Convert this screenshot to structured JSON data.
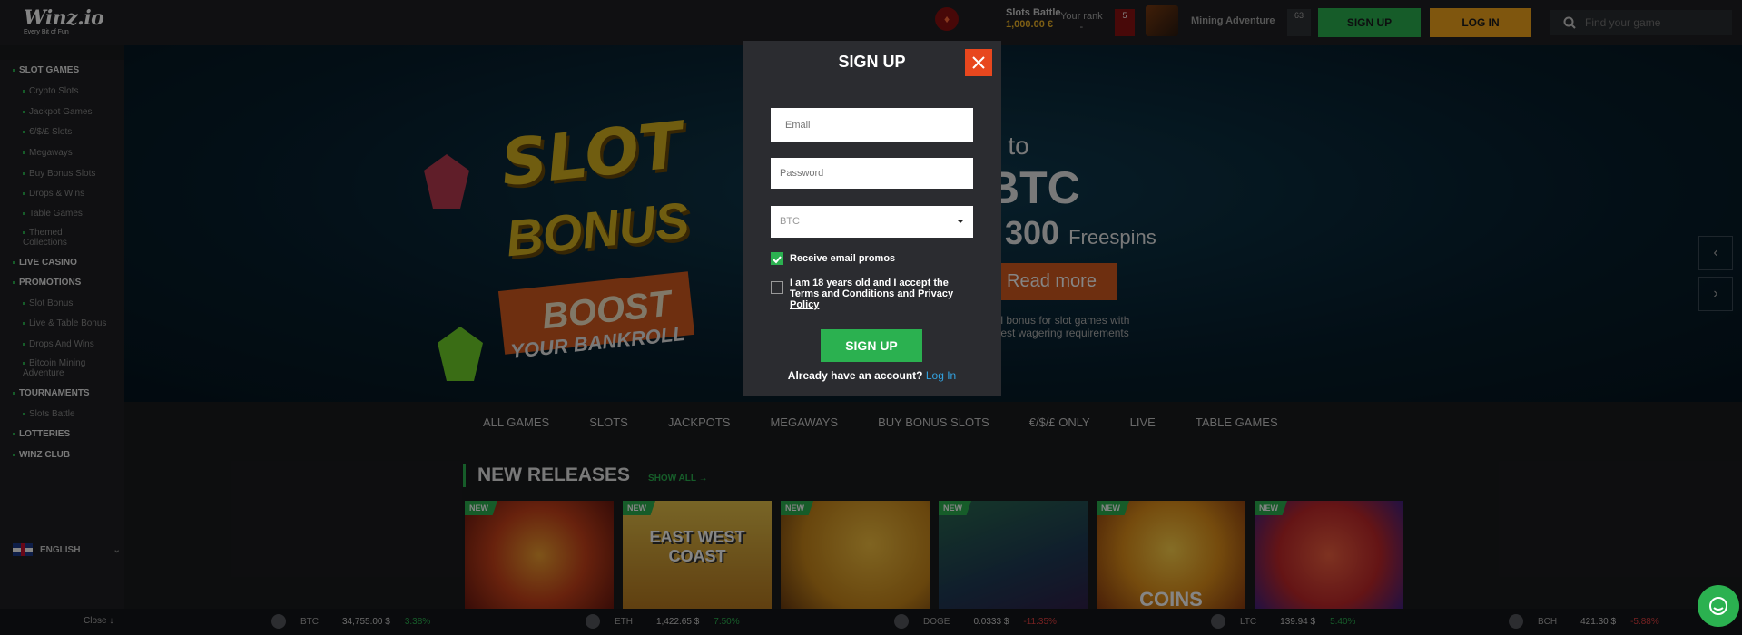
{
  "header": {
    "logo": "Winz.io",
    "logo_tagline": "Every Bit of Fun",
    "battle_title": "Slots Battle",
    "battle_amount": "1,000.00 €",
    "rank_label": "Your rank",
    "rank_value": "-",
    "rank_badge": "5",
    "mining_label": "Mining Adventure",
    "mining_badge": "63",
    "signup_label": "SIGN UP",
    "login_label": "LOG IN",
    "search_placeholder": "Find your game"
  },
  "sidebar": {
    "items": [
      {
        "label": "SLOT GAMES",
        "level": "main"
      },
      {
        "label": "Crypto Slots",
        "level": "sub"
      },
      {
        "label": "Jackpot Games",
        "level": "sub"
      },
      {
        "label": "€/$/£ Slots",
        "level": "sub"
      },
      {
        "label": "Megaways",
        "level": "sub"
      },
      {
        "label": "Buy Bonus Slots",
        "level": "sub"
      },
      {
        "label": "Drops & Wins",
        "level": "sub"
      },
      {
        "label": "Table Games",
        "level": "sub"
      },
      {
        "label": "Themed Collections",
        "level": "sub"
      },
      {
        "label": "LIVE CASINO",
        "level": "main"
      },
      {
        "label": "PROMOTIONS",
        "level": "main"
      },
      {
        "label": "Slot Bonus",
        "level": "sub"
      },
      {
        "label": "Live & Table Bonus",
        "level": "sub"
      },
      {
        "label": "Drops And Wins",
        "level": "sub"
      },
      {
        "label": "Bitcoin Mining Adventure",
        "level": "sub"
      },
      {
        "label": "TOURNAMENTS",
        "level": "main"
      },
      {
        "label": "Slots Battle",
        "level": "sub"
      },
      {
        "label": "LOTTERIES",
        "level": "main"
      },
      {
        "label": "WINZ CLUB",
        "level": "main"
      }
    ],
    "language": "ENGLISH"
  },
  "hero": {
    "slot_word": "SLOT",
    "bonus_word": "BONUS",
    "boost_word": "BOOST",
    "bankroll": "YOUR BANKROLL",
    "line1": "o to",
    "line2": "BTC",
    "line3_num": "300",
    "line3_word": "Freespins",
    "read_more": "Read more",
    "desc": "cial bonus for slot games with owest wagering requirements"
  },
  "categories": [
    "ALL GAMES",
    "SLOTS",
    "JACKPOTS",
    "MEGAWAYS",
    "BUY BONUS SLOTS",
    "€/$/£ ONLY",
    "LIVE",
    "TABLE GAMES"
  ],
  "new_releases": {
    "title": "NEW RELEASES",
    "show_all": "SHOW ALL",
    "badge": "NEW",
    "games": [
      {
        "name": "",
        "color": "#c8421a"
      },
      {
        "name": "EAST WEST COAST",
        "color": "#d8a52a"
      },
      {
        "name": "",
        "color": "#c8861a"
      },
      {
        "name": "",
        "color": "#1f4a55"
      },
      {
        "name": "COINS",
        "color": "#e0901a"
      },
      {
        "name": "",
        "color": "#c0282a"
      }
    ]
  },
  "ticker": {
    "close_label": "Close ↓",
    "coins": [
      {
        "symbol": "BTC",
        "price": "34,755.00 $",
        "change": "3.38%",
        "dir": "up"
      },
      {
        "symbol": "ETH",
        "price": "1,422.65 $",
        "change": "7.50%",
        "dir": "up"
      },
      {
        "symbol": "DOGE",
        "price": "0.0333 $",
        "change": "-11.35%",
        "dir": "down"
      },
      {
        "symbol": "LTC",
        "price": "139.94 $",
        "change": "5.40%",
        "dir": "up"
      },
      {
        "symbol": "BCH",
        "price": "421.30 $",
        "change": "-5.88%",
        "dir": "down"
      }
    ]
  },
  "modal": {
    "title": "SIGN UP",
    "email_placeholder": "Email",
    "password_placeholder": "Password",
    "currency": "BTC",
    "promo_label": "Receive email promos",
    "promo_checked": true,
    "terms_prefix": "I am 18 years old and I accept the ",
    "terms_link": "Terms and Conditions",
    "terms_mid": " and ",
    "privacy_link": "Privacy Policy",
    "terms_checked": false,
    "submit_label": "SIGN UP",
    "footer_text": "Already have an account?",
    "footer_link": "Log In"
  },
  "colors": {
    "green": "#2bb150",
    "orange": "#f4a51c",
    "red_close": "#e8471e",
    "link_blue": "#33a3e0"
  }
}
